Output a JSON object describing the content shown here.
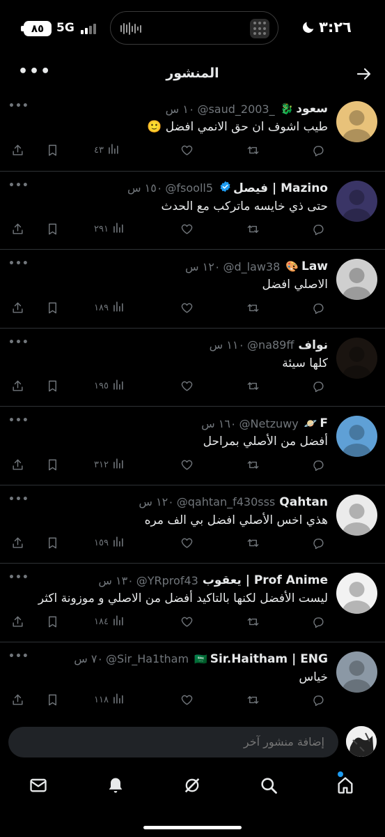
{
  "status_bar": {
    "time": "٣:٢٦",
    "battery": "٨٥",
    "network": "5G"
  },
  "header": {
    "title": "المنشور"
  },
  "replies": [
    {
      "name": "سعود",
      "badge": "🐉",
      "handle": "@saud_2003_",
      "time": "١٠ س",
      "text": "طيب اشوف ان حق الانمي افضل 🙂",
      "views": "٤٣",
      "avatar_color": "#e8c27a"
    },
    {
      "name": "فيصل | Mazino",
      "verified": true,
      "handle": "@fsooll5",
      "time": "١٥٠ س",
      "text": "حتى ذي خايسه ماتركب مع الحدث",
      "views": "٢٩١",
      "avatar_color": "#3a3566"
    },
    {
      "name": "Law",
      "badge": "🎨",
      "handle": "@d_law38",
      "time": "١٢٠ س",
      "text": "الاصلي افضل",
      "views": "١٨٩",
      "avatar_color": "#cfcfcf"
    },
    {
      "name": "نواف",
      "handle": "@na89ff",
      "time": "١١٠ س",
      "text": "كلها سيئة",
      "views": "١٩٥",
      "avatar_color": "#1a1410"
    },
    {
      "name": "F",
      "badge": "🪐",
      "handle": "@Netzuwy",
      "time": "١٦٠ س",
      "text": "أفضل من الأصلي بمراحل",
      "views": "٣١٢",
      "avatar_color": "#5fa0d6"
    },
    {
      "name": "Qahtan",
      "handle": "@qahtan_f430sss",
      "time": "١٢٠ س",
      "text": "هذي اخس الأصلي افضل بي الف مره",
      "views": "١٥٩",
      "avatar_color": "#ebebeb"
    },
    {
      "name": "يعقوب | Prof Anime",
      "handle": "@YRprof43",
      "time": "١٣٠ س",
      "text": "ليست الأفضل لكنها بالتاكيد أفضل من الاصلي و موزونة اكثر",
      "views": "١٨٤",
      "avatar_color": "#f2f2f2"
    },
    {
      "name": "Sir.Haitham | ENG",
      "badge": "🇸🇦",
      "handle": "@Sir_Ha1tham",
      "time": "٧٠ س",
      "text": "خياس",
      "views": "١١٨",
      "avatar_color": "#8b98a5"
    }
  ],
  "composer": {
    "placeholder": "إضافة منشور آخر"
  },
  "tabbar": {
    "items": [
      "home-icon",
      "search-icon",
      "grok-icon",
      "notifications-icon",
      "messages-icon"
    ]
  },
  "colors": {
    "background": "#000000",
    "text": "#e7e9ea",
    "muted": "#71767b",
    "divider": "#2f3336",
    "accent": "#1d9bf0"
  }
}
